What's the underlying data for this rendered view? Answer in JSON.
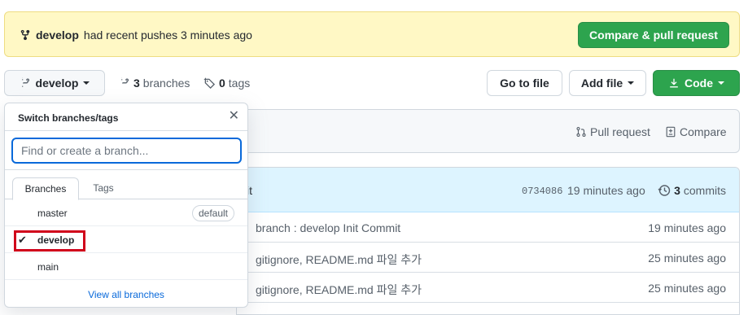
{
  "banner": {
    "branch": "develop",
    "message": "had recent pushes 3 minutes ago",
    "compare_button": "Compare & pull request"
  },
  "toolbar": {
    "branch_button": "develop",
    "branches_count": "3",
    "branches_label": "branches",
    "tags_count": "0",
    "tags_label": "tags",
    "goto_file": "Go to file",
    "add_file": "Add file",
    "code": "Code"
  },
  "compare_bar": {
    "pull_request": "Pull request",
    "compare": "Compare"
  },
  "commit_header": {
    "message_fragment": "it",
    "sha": "0734086",
    "ago": "19 minutes ago",
    "commits_count": "3",
    "commits_label": "commits"
  },
  "files": [
    {
      "message": "branch : develop Init Commit",
      "time": "19 minutes ago"
    },
    {
      "message": "gitignore, README.md 파일 추가",
      "time": "25 minutes ago"
    },
    {
      "message": "gitignore, README.md 파일 추가",
      "time": "25 minutes ago"
    }
  ],
  "dropdown": {
    "title": "Switch branches/tags",
    "filter_placeholder": "Find or create a branch...",
    "tabs": [
      "Branches",
      "Tags"
    ],
    "branches": [
      {
        "name": "master",
        "badge": "default"
      },
      {
        "name": "develop",
        "selected": true
      },
      {
        "name": "main"
      }
    ],
    "view_all": "View all branches"
  },
  "colors": {
    "green": "#2da44e",
    "banner_bg": "#fff8c5",
    "link": "#0969da",
    "highlight": "#d0021b"
  }
}
